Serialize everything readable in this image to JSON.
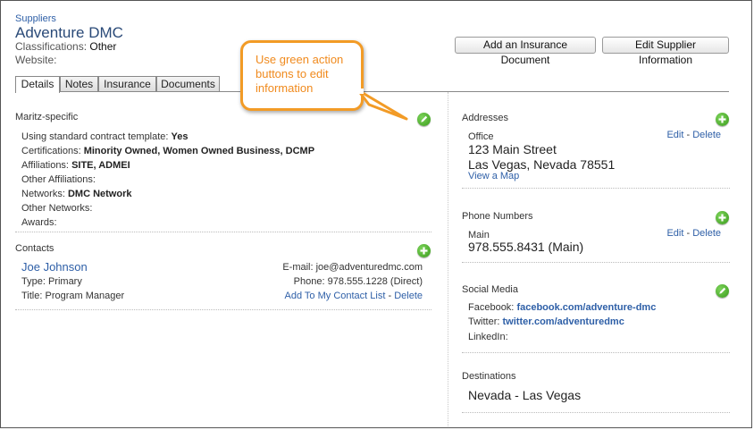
{
  "header": {
    "breadcrumb": "Suppliers",
    "supplier_name": "Adventure DMC",
    "classifications_label": "Classifications:",
    "classifications_value": "Other",
    "website_label": "Website:"
  },
  "actions": {
    "add_insurance": "Add an Insurance Document",
    "edit_supplier": "Edit Supplier Information"
  },
  "tabs": [
    {
      "label": "Details",
      "active": true
    },
    {
      "label": "Notes"
    },
    {
      "label": "Insurance"
    },
    {
      "label": "Documents"
    }
  ],
  "callout": {
    "text": "Use green action buttons to edit information"
  },
  "maritz": {
    "title": "Maritz-specific",
    "rows": [
      {
        "label": "Using standard contract template:",
        "value": "Yes"
      },
      {
        "label": "Certifications:",
        "value": "Minority Owned, Women Owned Business, DCMP"
      },
      {
        "label": "Affiliations:",
        "value": "SITE, ADMEI"
      },
      {
        "label": "Other Affiliations:",
        "value": ""
      },
      {
        "label": "Networks:",
        "value": "DMC Network"
      },
      {
        "label": "Other Networks:",
        "value": ""
      },
      {
        "label": "Awards:",
        "value": ""
      }
    ]
  },
  "contacts": {
    "title": "Contacts",
    "name": "Joe Johnson",
    "type": "Type: Primary",
    "title_line": "Title: Program Manager",
    "email": "E-mail: joe@adventuredmc.com",
    "phone": "Phone: 978.555.1228 (Direct)",
    "add_link": "Add To My Contact List",
    "separator": "-",
    "delete_link": "Delete"
  },
  "addresses": {
    "title": "Addresses",
    "type": "Office",
    "street": "123 Main Street",
    "city": "Las Vegas, Nevada 78551",
    "map_link": "View a Map",
    "edit_link": "Edit",
    "separator": "-",
    "delete_link": "Delete"
  },
  "phones": {
    "title": "Phone Numbers",
    "type": "Main",
    "number": "978.555.8431 (Main)",
    "edit_link": "Edit",
    "separator": "-",
    "delete_link": "Delete"
  },
  "social": {
    "title": "Social Media",
    "facebook_label": "Facebook:",
    "facebook_value": "facebook.com/adventure-dmc",
    "twitter_label": "Twitter:",
    "twitter_value": "twitter.com/adventuredmc",
    "linkedin_label": "LinkedIn:"
  },
  "destinations": {
    "title": "Destinations",
    "value": "Nevada - Las Vegas"
  },
  "colors": {
    "link": "#2e5fa7",
    "action_green": "#3a9b1c",
    "callout_orange": "#f29b26"
  },
  "icons": {
    "edit": "pencil-icon",
    "add": "plus-icon"
  }
}
